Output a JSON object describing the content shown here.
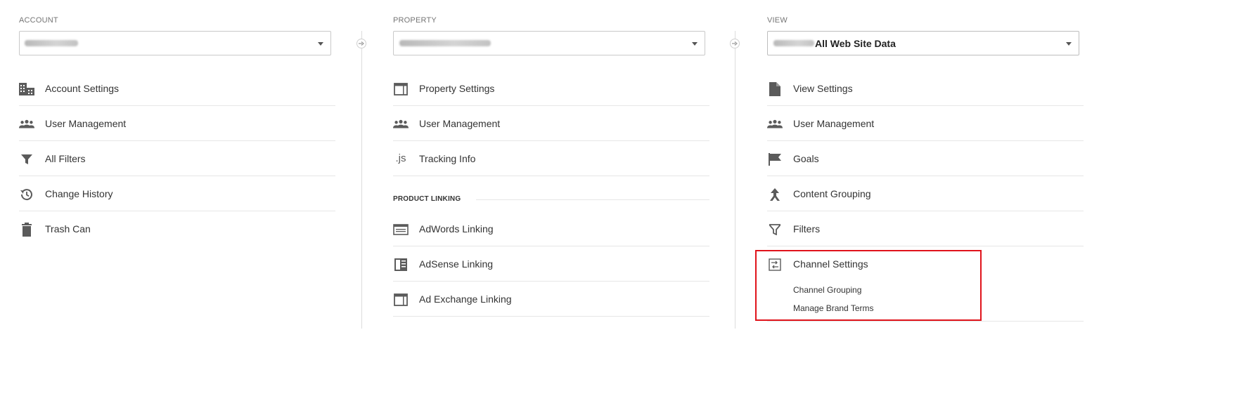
{
  "account": {
    "label": "ACCOUNT",
    "items": [
      {
        "label": "Account Settings",
        "icon": "building-icon"
      },
      {
        "label": "User Management",
        "icon": "users-icon"
      },
      {
        "label": "All Filters",
        "icon": "filter-icon"
      },
      {
        "label": "Change History",
        "icon": "history-icon"
      },
      {
        "label": "Trash Can",
        "icon": "trash-icon"
      }
    ]
  },
  "property": {
    "label": "PROPERTY",
    "items": [
      {
        "label": "Property Settings",
        "icon": "window-icon"
      },
      {
        "label": "User Management",
        "icon": "users-icon"
      },
      {
        "label": "Tracking Info",
        "icon": "js-icon",
        "icon_text": ".js"
      }
    ],
    "product_linking": {
      "heading": "PRODUCT LINKING",
      "items": [
        {
          "label": "AdWords Linking",
          "icon": "adwords-icon"
        },
        {
          "label": "AdSense Linking",
          "icon": "adsense-icon"
        },
        {
          "label": "Ad Exchange Linking",
          "icon": "window-icon"
        }
      ]
    }
  },
  "view": {
    "label": "VIEW",
    "selected_value": "All Web Site Data",
    "items": [
      {
        "label": "View Settings",
        "icon": "document-icon"
      },
      {
        "label": "User Management",
        "icon": "users-icon"
      },
      {
        "label": "Goals",
        "icon": "flag-icon"
      },
      {
        "label": "Content Grouping",
        "icon": "content-grouping-icon"
      },
      {
        "label": "Filters",
        "icon": "filter-icon"
      },
      {
        "label": "Channel Settings",
        "icon": "channel-settings-icon"
      }
    ],
    "channel_sub_items": [
      "Channel Grouping",
      "Manage Brand Terms"
    ]
  },
  "colors": {
    "highlight": "#e0131b",
    "icon": "#5b5b5b",
    "divider": "#e6e6e6"
  }
}
